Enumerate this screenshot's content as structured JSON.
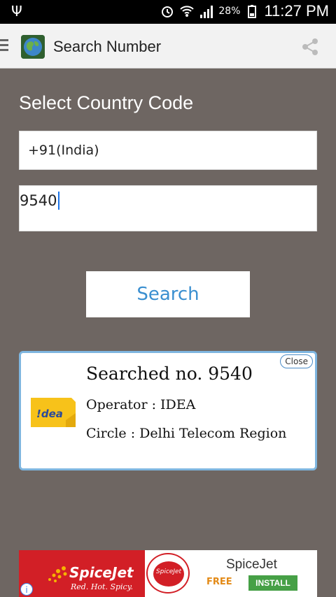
{
  "status_bar": {
    "battery": "28%",
    "time": "11:27 PM",
    "icons": [
      "usb-icon",
      "alarm-icon",
      "wifi-icon",
      "signal-icon",
      "battery-icon"
    ]
  },
  "app_bar": {
    "title": "Search Number",
    "icons": [
      "menu-icon",
      "app-logo-globe",
      "share-icon"
    ]
  },
  "form": {
    "heading": "Select Country Code",
    "country_value": "+91(India)",
    "number_value": "9540",
    "search_label": "Search"
  },
  "result": {
    "close_label": "Close",
    "searched": "Searched no. 9540",
    "operator": "Operator : IDEA",
    "circle": "Circle : Delhi Telecom Region",
    "logo_text": "!dea"
  },
  "ad": {
    "brand": "SpiceJet",
    "tagline": "Red. Hot. Spicy.",
    "circle_text": "SpiceJet",
    "app_name": "SpiceJet",
    "free_label": "FREE",
    "install_label": "INSTALL",
    "info_label": "i",
    "colors": {
      "brand_red": "#d21f26",
      "install_green": "#46a046",
      "free_orange": "#e38a17"
    }
  }
}
